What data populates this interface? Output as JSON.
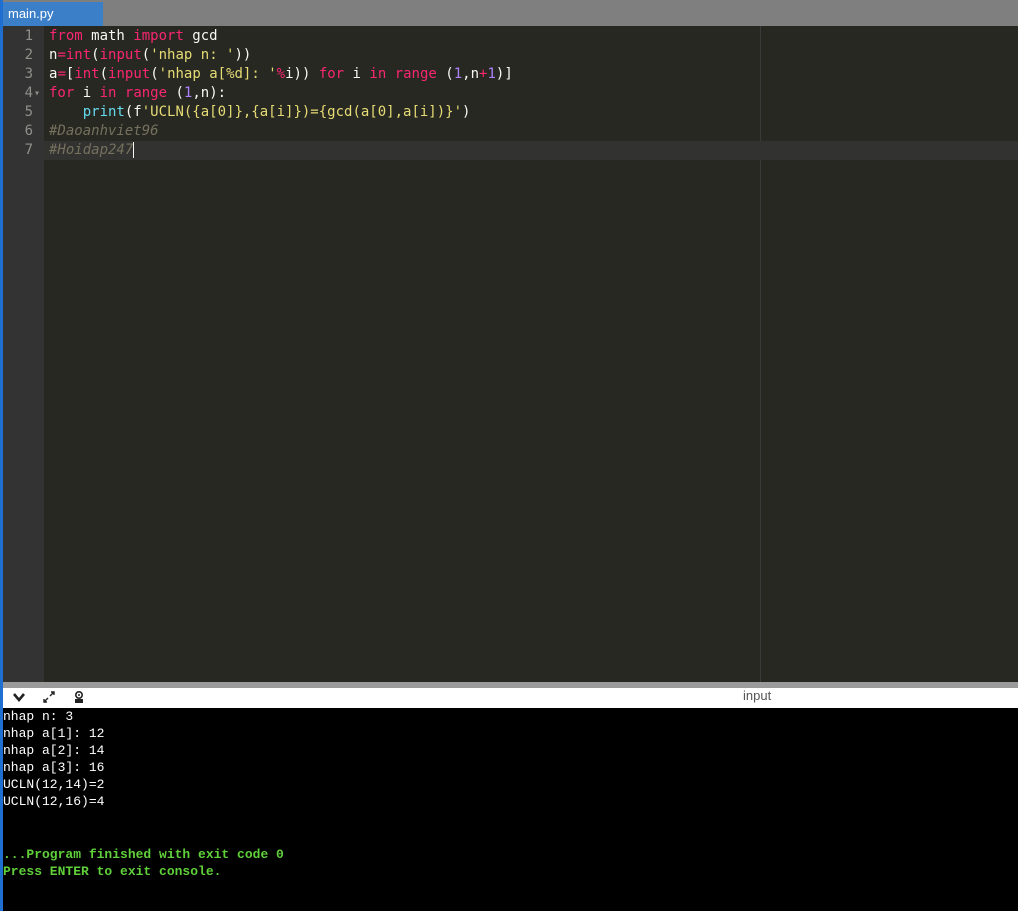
{
  "tab": {
    "filename": "main.py"
  },
  "editor": {
    "line_numbers": [
      "1",
      "2",
      "3",
      "4",
      "5",
      "6",
      "7"
    ],
    "fold_marker": "▾",
    "lines": [
      [
        {
          "t": "from",
          "c": "kw"
        },
        {
          "t": " math ",
          "c": ""
        },
        {
          "t": "import",
          "c": "kw"
        },
        {
          "t": " gcd",
          "c": ""
        }
      ],
      [
        {
          "t": "n",
          "c": ""
        },
        {
          "t": "=",
          "c": "op"
        },
        {
          "t": "int",
          "c": "k"
        },
        {
          "t": "(",
          "c": ""
        },
        {
          "t": "input",
          "c": "k"
        },
        {
          "t": "(",
          "c": ""
        },
        {
          "t": "'nhap n: '",
          "c": "st"
        },
        {
          "t": "))",
          "c": ""
        }
      ],
      [
        {
          "t": "a",
          "c": ""
        },
        {
          "t": "=",
          "c": "op"
        },
        {
          "t": "[",
          "c": ""
        },
        {
          "t": "int",
          "c": "k"
        },
        {
          "t": "(",
          "c": ""
        },
        {
          "t": "input",
          "c": "k"
        },
        {
          "t": "(",
          "c": ""
        },
        {
          "t": "'nhap a[%d]: '",
          "c": "st"
        },
        {
          "t": "%",
          "c": "op"
        },
        {
          "t": "i)) ",
          "c": ""
        },
        {
          "t": "for",
          "c": "kw"
        },
        {
          "t": " i ",
          "c": ""
        },
        {
          "t": "in",
          "c": "kw"
        },
        {
          "t": " ",
          "c": ""
        },
        {
          "t": "range",
          "c": "k"
        },
        {
          "t": " (",
          "c": ""
        },
        {
          "t": "1",
          "c": "nu"
        },
        {
          "t": ",n",
          "c": ""
        },
        {
          "t": "+",
          "c": "op"
        },
        {
          "t": "1",
          "c": "nu"
        },
        {
          "t": ")]",
          "c": ""
        }
      ],
      [
        {
          "t": "for",
          "c": "kw"
        },
        {
          "t": " i ",
          "c": ""
        },
        {
          "t": "in",
          "c": "kw"
        },
        {
          "t": " ",
          "c": ""
        },
        {
          "t": "range",
          "c": "k"
        },
        {
          "t": " (",
          "c": ""
        },
        {
          "t": "1",
          "c": "nu"
        },
        {
          "t": ",n):",
          "c": ""
        }
      ],
      [
        {
          "t": "    ",
          "c": ""
        },
        {
          "t": "print",
          "c": "fn"
        },
        {
          "t": "(f",
          "c": ""
        },
        {
          "t": "'UCLN({a[0]},{a[i]})={gcd(a[0],a[i])}'",
          "c": "st"
        },
        {
          "t": ")",
          "c": ""
        }
      ],
      [
        {
          "t": "#Daoanhviet96",
          "c": "cm"
        }
      ],
      [
        {
          "t": "#Hoidap247",
          "c": "cm"
        }
      ]
    ]
  },
  "console": {
    "input_label": "input",
    "output_lines": [
      "nhap n: 3",
      "nhap a[1]: 12",
      "nhap a[2]: 14",
      "nhap a[3]: 16",
      "UCLN(12,14)=2",
      "UCLN(12,16)=4"
    ],
    "finish_lines": [
      "...Program finished with exit code 0",
      "Press ENTER to exit console."
    ],
    "icons": [
      "chevron-down-icon",
      "expand-icon",
      "settings-icon"
    ]
  },
  "colors": {
    "tab_active": "#3c7fc9",
    "editor_bg": "#272822",
    "console_bg": "#000000",
    "console_ok": "#5fcf3a"
  }
}
